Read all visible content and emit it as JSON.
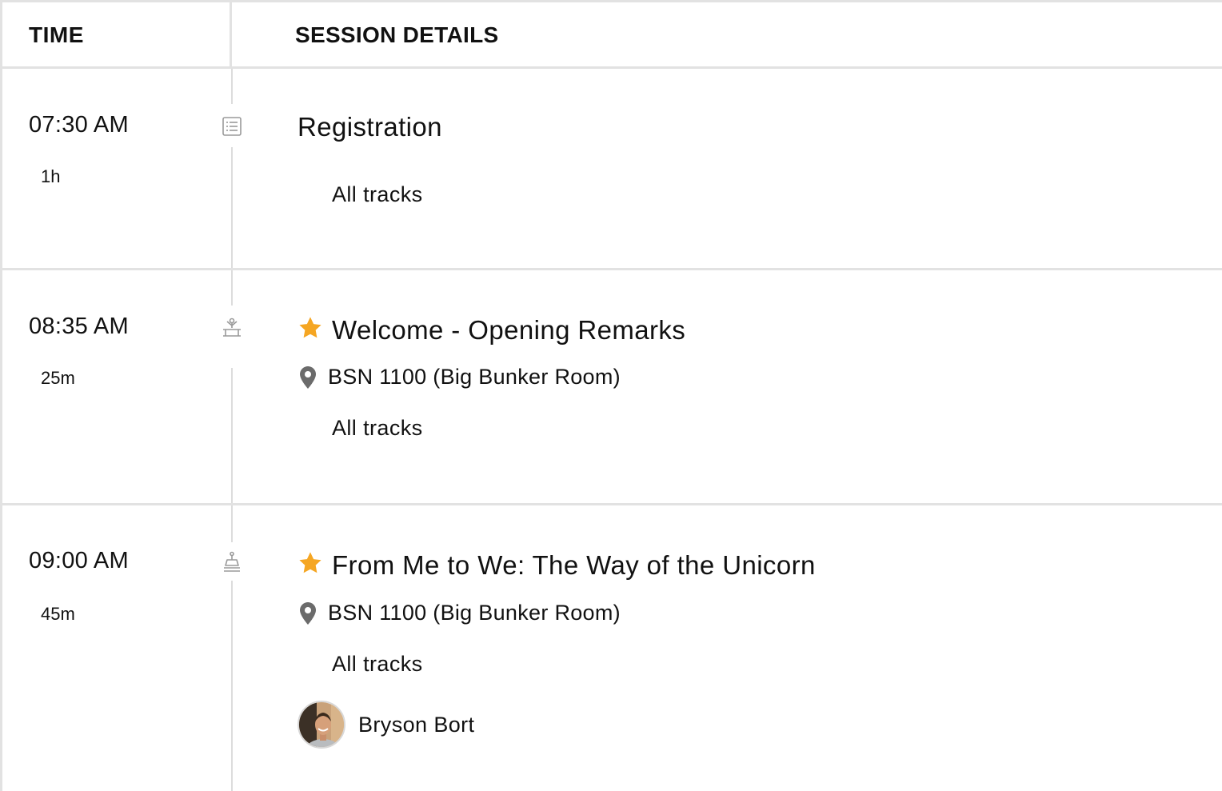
{
  "header": {
    "time_label": "TIME",
    "details_label": "SESSION DETAILS"
  },
  "sessions": [
    {
      "time": "07:30 AM",
      "duration": "1h",
      "icon": "list-icon",
      "title": "Registration",
      "starred": false,
      "location": "",
      "tracks": "All tracks",
      "speaker": ""
    },
    {
      "time": "08:35 AM",
      "duration": "25m",
      "icon": "keynote-icon",
      "title": "Welcome - Opening Remarks",
      "starred": true,
      "location": "BSN 1100 (Big Bunker Room)",
      "tracks": "All tracks",
      "speaker": ""
    },
    {
      "time": "09:00 AM",
      "duration": "45m",
      "icon": "podium-icon",
      "title": "From Me to We: The Way of the Unicorn",
      "starred": true,
      "location": "BSN 1100 (Big Bunker Room)",
      "tracks": "All tracks",
      "speaker": "Bryson Bort"
    }
  ],
  "colors": {
    "star": "#f5a623",
    "divider": "#e2e2e2",
    "pin": "#6b6b6b"
  }
}
